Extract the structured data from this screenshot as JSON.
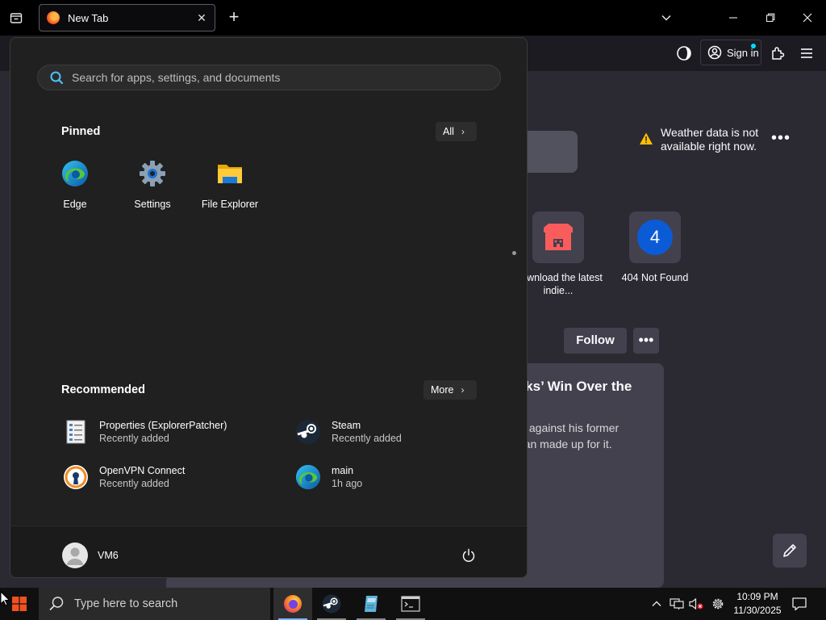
{
  "browser": {
    "tab": {
      "title": "New Tab"
    },
    "new_tab_symbol": "+",
    "signin": {
      "label": "Sign in"
    }
  },
  "newtab_page": {
    "weather": {
      "message": "Weather data is not available right now."
    },
    "shortcuts": [
      {
        "label": "Download the latest indie...",
        "icon": "itch-io-icon"
      },
      {
        "label": "404 Not Found",
        "icon_letter": "4"
      }
    ],
    "follow_label": "Follow",
    "story": {
      "headline": "wks’ Win Over the",
      "description_line1": "ck against his former",
      "description_line2": "than made up for it."
    }
  },
  "start_menu": {
    "search_placeholder": "Search for apps, settings, and documents",
    "pinned_title": "Pinned",
    "all_label": "All",
    "pinned": [
      {
        "label": "Edge",
        "icon": "edge-icon"
      },
      {
        "label": "Settings",
        "icon": "gear-icon"
      },
      {
        "label": "File Explorer",
        "icon": "folder-icon"
      }
    ],
    "recommended_title": "Recommended",
    "more_label": "More",
    "recommended": [
      {
        "name": "Properties (ExplorerPatcher)",
        "sub": "Recently added",
        "icon": "properties-icon"
      },
      {
        "name": "Steam",
        "sub": "Recently added",
        "icon": "steam-icon"
      },
      {
        "name": "OpenVPN Connect",
        "sub": "Recently added",
        "icon": "openvpn-icon"
      },
      {
        "name": "main",
        "sub": "1h ago",
        "icon": "edge-icon"
      }
    ],
    "user": {
      "name": "VM6"
    }
  },
  "taskbar": {
    "search_placeholder": "Type here to search",
    "apps": [
      "firefox-icon",
      "steam-icon",
      "notepad-icon",
      "terminal-icon"
    ],
    "clock": {
      "time": "10:09 PM",
      "date": "11/30/2025"
    }
  },
  "colors": {
    "start_bg": "#202020",
    "page_bg": "#2b2a33",
    "accent": "#00ddff",
    "taskbar_indicator": "#7fb2ff"
  }
}
